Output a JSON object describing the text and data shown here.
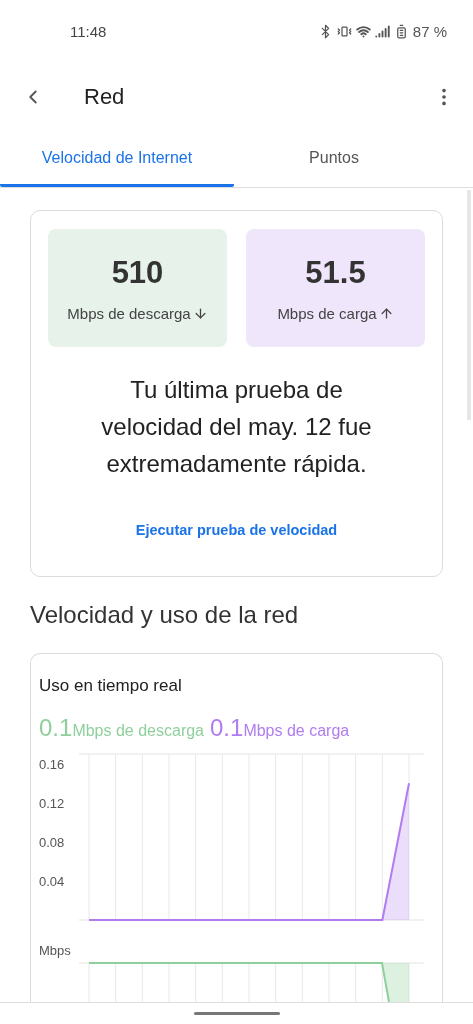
{
  "status_bar": {
    "time": "11:48",
    "battery": "87 %"
  },
  "app_bar": {
    "title": "Red"
  },
  "tabs": [
    {
      "label": "Velocidad de Internet",
      "selected": true
    },
    {
      "label": "Puntos",
      "selected": false
    }
  ],
  "speed_test": {
    "results": [
      {
        "kind": "download",
        "value": "510",
        "label": "Mbps de descarga",
        "color": "#e6f2ea"
      },
      {
        "kind": "upload",
        "value": "51.5",
        "label": "Mbps de carga",
        "color": "#efe6fb"
      }
    ],
    "summary": "Tu última prueba de velocidad del may. 12 fue extremadamente rápida.",
    "action": "Ejecutar prueba de velocidad"
  },
  "section_title": "Velocidad y uso de la red",
  "realtime": {
    "title": "Uso en tiempo real",
    "download_value": "0.1",
    "download_label": "Mbps de descarga",
    "upload_value": "0.1",
    "upload_label": "Mbps de carga",
    "chart_data": {
      "type": "area",
      "grid": true,
      "ylim": [
        0,
        0.17
      ],
      "yticks": [
        0.04,
        0.08,
        0.12,
        0.16
      ],
      "series": [
        {
          "color": "#b07cf0",
          "values": [
            0,
            0,
            0,
            0,
            0,
            0,
            0,
            0,
            0,
            0,
            0,
            0,
            0.14
          ]
        }
      ]
    },
    "lower_axis_label": "Mbps"
  }
}
